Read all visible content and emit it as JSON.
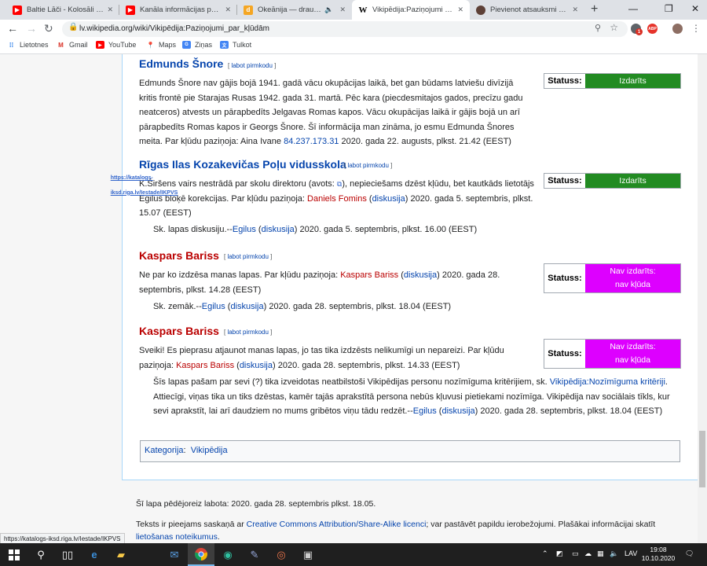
{
  "browser": {
    "tabs": [
      {
        "title": "Baltie Lāči - Kolosāli (Mēs ar",
        "favicon": "youtube-icon",
        "color": "#ff0000"
      },
      {
        "title": "Kanāla informācijas panelis",
        "favicon": "youtube-icon",
        "color": "#ff0000"
      },
      {
        "title": "Okeānija — draugiem.lv",
        "favicon": "draugiem-icon",
        "color": "#f5a623"
      },
      {
        "title": "Vikipēdija:Paziņojumi par kļū",
        "favicon": "wikipedia-icon",
        "color": "#ffffff"
      },
      {
        "title": "Pievienot atsauksmi vai sūdz",
        "favicon": "review-icon",
        "color": "#5d4037"
      }
    ],
    "url": "lv.wikipedia.org/wiki/Vikipēdija:Paziņojumi_par_kļūdām",
    "bookmarks": [
      {
        "label": "Lietotnes",
        "icon": "apps-grid-icon"
      },
      {
        "label": "Gmail",
        "icon": "gmail-icon"
      },
      {
        "label": "YouTube",
        "icon": "youtube-icon"
      },
      {
        "label": "Maps",
        "icon": "maps-pin-icon"
      },
      {
        "label": "Ziņas",
        "icon": "news-icon"
      },
      {
        "label": "Tulkot",
        "icon": "translate-icon"
      }
    ],
    "extension_badges": [
      "1",
      "ABP"
    ],
    "status_url": "https://katalogs-iksd.riga.lv/Iestade/IKPVS"
  },
  "sections": [
    {
      "heading": "Edmunds Šnore",
      "edit": "labot pirmkodu",
      "text": "Edmunds Šnore nav gājis bojā 1941. gadā vācu okupācijas laikā, bet gan būdams latviešu divīzijā kritis frontē pie Starajas Rusas 1942. gada 31. martā. Pēc kara (piecdesmitajos gados, precīzu gadu neatceros) atvests un pārapbedīts Jelgavas Romas kapos. Vācu okupācijas laikā ir gājis bojā un arī pārapbedīts Romas kapos ir Georgs Šnore. Šī informācija man zināma, jo esmu Edmunda Šnores meita. Par kļūdu paziņoja: Aina Ivane",
      "ip": "84.237.173.31",
      "date": "2020. gada 22. augusts, plkst. 21.42 (EEST)",
      "status_label": "Statuss:",
      "status_value": "Izdarīts",
      "status_color": "#228b22"
    },
    {
      "heading": "Rīgas Ilas Kozakevičas Poļu vidusskola",
      "edit": "labot pirmkodu",
      "text_a": "K.Širšens vairs nestrādā par skolu direktoru (avots: ",
      "link": "https://katalogs-iksd.riga.lv/Iestade/IKPVS",
      "text_b": "), nepieciešams dzēst kļūdu, bet kautkāds lietotājs Egilus bloķē korekcijas. Par kļūdu paziņoja: ",
      "user": "Daniels Fomins",
      "talk": "diskusija",
      "date": "2020. gada 5. septembris, plkst. 15.07 (EEST)",
      "reply_a": "Sk. lapas diskusiju.--",
      "reply_user": "Egilus",
      "reply_talk": "diskusija",
      "reply_date": "2020. gada 5. septembris, plkst. 16.00 (EEST)",
      "status_label": "Statuss:",
      "status_value": "Izdarīts",
      "status_color": "#228b22"
    },
    {
      "heading": "Kaspars Bariss",
      "edit": "labot pirmkodu",
      "text_a": "Ne par ko izdzēsa manas lapas. Par kļūdu paziņoja: ",
      "user": "Kaspars Bariss",
      "talk": "diskusija",
      "date": "2020. gada 28. septembris, plkst. 14.28 (EEST)",
      "reply_a": "Sk. zemāk.--",
      "reply_user": "Egilus",
      "reply_talk": "diskusija",
      "reply_date": "2020. gada 28. septembris, plkst. 18.04 (EEST)",
      "status_label": "Statuss:",
      "status_value_1": "Nav izdarīts:",
      "status_value_2": "nav kļūda",
      "status_color": "#dd00ff"
    },
    {
      "heading": "Kaspars Bariss",
      "edit": "labot pirmkodu",
      "text_a": "Sveiki! Es pieprasu atjaunot manas lapas, jo tas tika izdzēsts nelikumīgi un nepareizi. Par kļūdu paziņoja: ",
      "user": "Kaspars Bariss",
      "talk": "diskusija",
      "date": "2020. gada 28. septembris, plkst. 14.33 (EEST)",
      "reply_a": "Šīs lapas pašam par sevi (?) tika izveidotas neatbilstoši Vikipēdijas personu nozīmīguma kritērijiem, sk. ",
      "reply_link": "Vikipēdija:Nozīmīguma kritēriji",
      "reply_b": ". Attiecīgi, viņas tika un tiks dzēstas, kamēr tajās aprakstītā persona nebūs kļuvusi pietiekami nozīmīga. Vikipēdija nav sociālais tīkls, kur sevi aprakstīt, lai arī daudziem no mums gribētos viņu tādu redzēt.--",
      "reply_user": "Egilus",
      "reply_talk": "diskusija",
      "reply_date": "2020. gada 28. septembris, plkst. 18.04 (EEST)",
      "status_label": "Statuss:",
      "status_value_1": "Nav izdarīts:",
      "status_value_2": "nav kļūda",
      "status_color": "#dd00ff"
    }
  ],
  "category": {
    "label": "Kategorija",
    "value": "Vikipēdija"
  },
  "footer": {
    "last_edit": "Šī lapa pēdējoreiz labota: 2020. gada 28. septembris plkst. 18.05.",
    "license_a": "Teksts ir pieejams saskaņā ar ",
    "license_link": "Creative Commons Attribution/Share-Alike licenci",
    "license_b": "; var pastāvēt papildu ierobežojumi. Plašākai informācijai skatīt ",
    "terms_link": "lietošanas noteikumus"
  },
  "taskbar": {
    "apps": [
      "start-icon",
      "search-icon",
      "task-view-icon",
      "edge-legacy-icon",
      "file-explorer-icon",
      "mail-icon",
      "chrome-icon",
      "edge-icon",
      "photos-icon",
      "app-icon",
      "terminal-icon"
    ],
    "language": "LAV",
    "time": "19:08",
    "date": "10.10.2020"
  }
}
